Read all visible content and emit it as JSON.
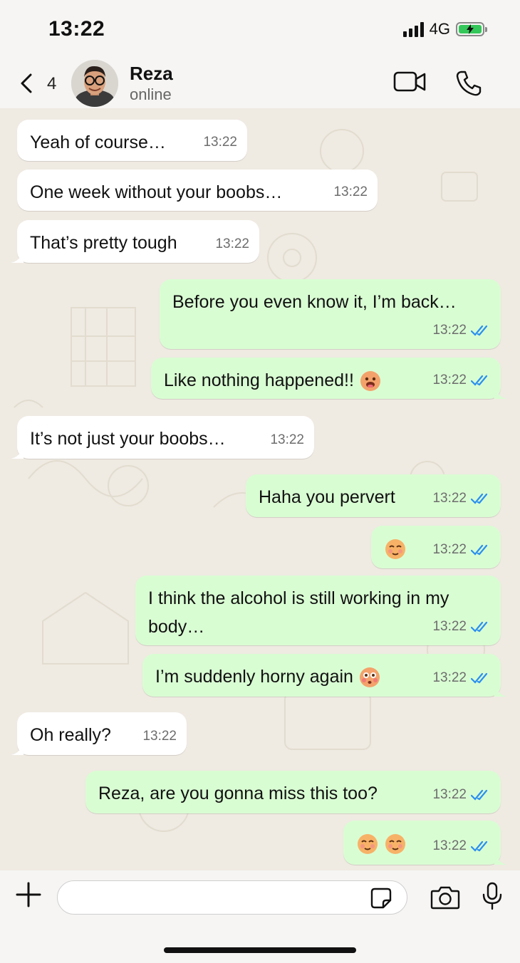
{
  "status_bar": {
    "time": "13:22",
    "network": "4G",
    "battery_charging": true
  },
  "header": {
    "back_count": "4",
    "contact_name": "Reza",
    "contact_status": "online",
    "icons": [
      "back-chevron-icon",
      "video-call-icon",
      "phone-call-icon"
    ]
  },
  "messages": [
    {
      "dir": "in",
      "text": "Yeah of course…",
      "time": "13:22"
    },
    {
      "dir": "in",
      "text": "One week without your boobs…",
      "time": "13:22"
    },
    {
      "dir": "in",
      "text": "That’s pretty tough",
      "time": "13:22",
      "tail": true
    },
    {
      "dir": "out",
      "text": "Before you even know it, I’m back…",
      "time": "13:22",
      "read": true
    },
    {
      "dir": "out",
      "text": "Like nothing happened!!",
      "emoji": [
        "drooling-face"
      ],
      "time": "13:22",
      "read": true,
      "tail": true
    },
    {
      "dir": "in",
      "text": "It’s not just your boobs…",
      "time": "13:22",
      "tail": true
    },
    {
      "dir": "out",
      "text": "Haha you pervert",
      "time": "13:22",
      "read": true
    },
    {
      "dir": "out",
      "text": "",
      "emoji": [
        "relieved-face"
      ],
      "time": "13:22",
      "read": true
    },
    {
      "dir": "out",
      "text": "I think the alcohol is still working in my body…",
      "time": "13:22",
      "read": true
    },
    {
      "dir": "out",
      "text": "I’m suddenly horny again",
      "emoji": [
        "flushed-face"
      ],
      "time": "13:22",
      "read": true,
      "tail": true
    },
    {
      "dir": "in",
      "text": "Oh really?",
      "time": "13:22",
      "tail": true
    },
    {
      "dir": "out",
      "text": "Reza, are you gonna miss this too?",
      "time": "13:22",
      "read": true
    },
    {
      "dir": "out",
      "text": "",
      "emoji": [
        "relieved-face",
        "relieved-face"
      ],
      "time": "13:22",
      "read": true,
      "tail": true
    }
  ],
  "composer": {
    "input_value": "",
    "icons": [
      "plus-icon",
      "sticker-icon",
      "camera-icon",
      "microphone-icon"
    ]
  },
  "colors": {
    "incoming_bubble": "#ffffff",
    "outgoing_bubble": "#d9fdd3",
    "read_tick": "#2b8ff0",
    "chat_background": "#efeae2"
  }
}
